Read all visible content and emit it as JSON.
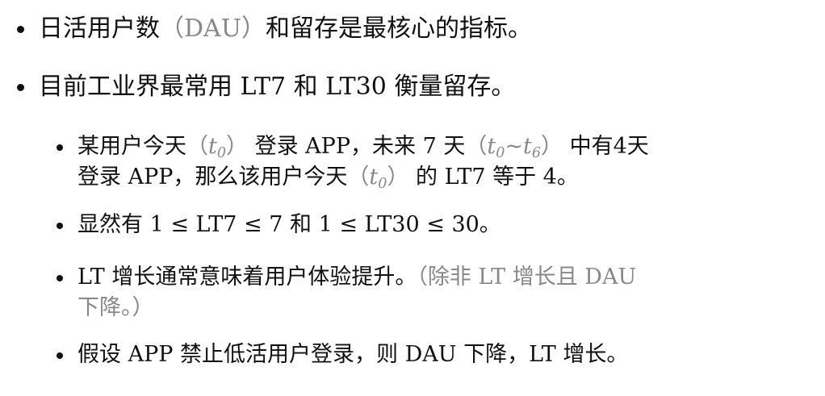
{
  "bullets": [
    {
      "before": "日活用户数",
      "grey": "（DAU）",
      "after": "和留存是最核心的指标。"
    },
    {
      "text": "目前工业界最常用 LT7 和 LT30 衡量留存。"
    }
  ],
  "sub_bullets": [
    {
      "line1": {
        "a": "某用户今天",
        "g1_open": "（",
        "t": "t",
        "t_sub": "0",
        "g1_close": "）",
        "b": " 登录 APP，未来 7 天",
        "g2_open": "（",
        "t2": "t",
        "t2_sub": "0",
        "tilde": "~",
        "t3": "t",
        "t3_sub": "6",
        "g2_close": "）",
        "c": " 中有4天"
      },
      "line2": {
        "a": "登录 APP，那么该用户今天",
        "g_open": "（",
        "t": "t",
        "t_sub": "0",
        "g_close": "）",
        "b": " 的 LT7 等于 4。"
      }
    },
    {
      "text": "显然有 1 ≤ LT7 ≤ 7 和 1 ≤ LT30 ≤ 30。"
    },
    {
      "line1_black": "LT 增长通常意味着用户体验提升。",
      "line1_grey": "（除非 LT 增长且 DAU",
      "line2_grey": "下降。）"
    },
    {
      "text": "假设 APP 禁止低活用户登录，则 DAU 下降，LT 增长。"
    }
  ]
}
